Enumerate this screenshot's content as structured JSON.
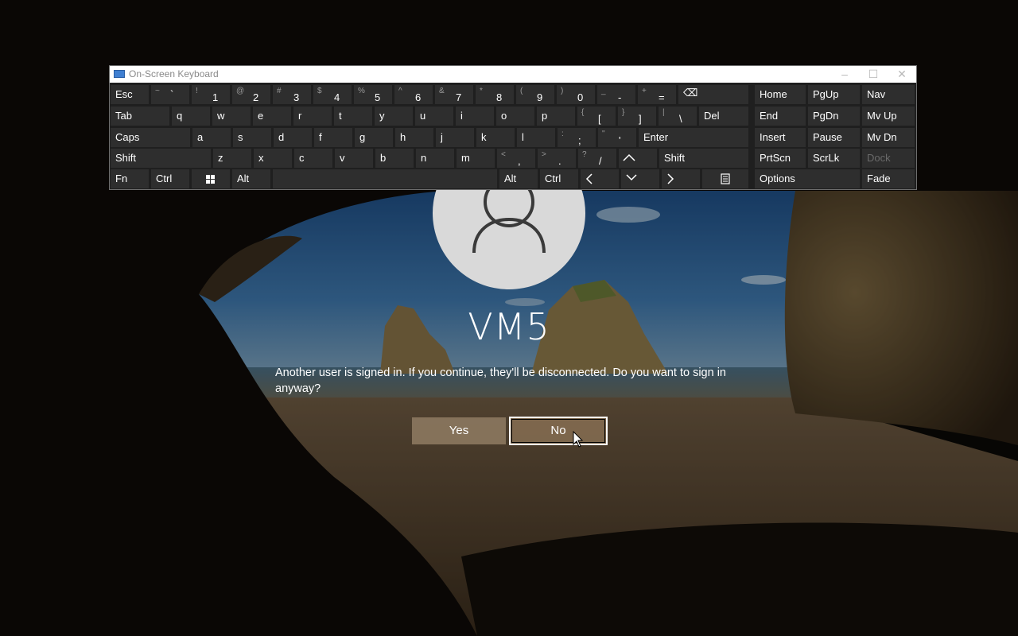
{
  "lockscreen": {
    "username": "VM5",
    "message": "Another user is signed in. If you continue, they'll be disconnected. Do you want to sign in anyway?",
    "yes_label": "Yes",
    "no_label": "No"
  },
  "osk": {
    "title": "On-Screen Keyboard",
    "minimize": "–",
    "maximize": "☐",
    "close": "✕",
    "row1": {
      "esc": "Esc",
      "tilde": {
        "sec": "~",
        "main": "`"
      },
      "k1": {
        "sec": "!",
        "main": "1"
      },
      "k2": {
        "sec": "@",
        "main": "2"
      },
      "k3": {
        "sec": "#",
        "main": "3"
      },
      "k4": {
        "sec": "$",
        "main": "4"
      },
      "k5": {
        "sec": "%",
        "main": "5"
      },
      "k6": {
        "sec": "^",
        "main": "6"
      },
      "k7": {
        "sec": "&",
        "main": "7"
      },
      "k8": {
        "sec": "*",
        "main": "8"
      },
      "k9": {
        "sec": "(",
        "main": "9"
      },
      "k0": {
        "sec": ")",
        "main": "0"
      },
      "minus": {
        "sec": "_",
        "main": "-"
      },
      "equals": {
        "sec": "+",
        "main": "="
      },
      "backspace": "⌫"
    },
    "row2": {
      "tab": "Tab",
      "q": "q",
      "w": "w",
      "e": "e",
      "r": "r",
      "t": "t",
      "y": "y",
      "u": "u",
      "i": "i",
      "o": "o",
      "p": "p",
      "lbracket": {
        "sec": "{",
        "main": "["
      },
      "rbracket": {
        "sec": "}",
        "main": "]"
      },
      "backslash": {
        "sec": "|",
        "main": "\\"
      },
      "del": "Del"
    },
    "row3": {
      "caps": "Caps",
      "a": "a",
      "s": "s",
      "d": "d",
      "f": "f",
      "g": "g",
      "h": "h",
      "j": "j",
      "k": "k",
      "l": "l",
      "semicolon": {
        "sec": ":",
        "main": ";"
      },
      "quote": {
        "sec": "\"",
        "main": "'"
      },
      "enter": "Enter"
    },
    "row4": {
      "shift_left": "Shift",
      "z": "z",
      "x": "x",
      "c": "c",
      "v": "v",
      "b": "b",
      "n": "n",
      "m": "m",
      "comma": {
        "sec": "<",
        "main": ","
      },
      "period": {
        "sec": ">",
        "main": "."
      },
      "slash": {
        "sec": "?",
        "main": "/"
      },
      "shift_right": "Shift"
    },
    "row5": {
      "fn": "Fn",
      "ctrl_left": "Ctrl",
      "alt_left": "Alt",
      "alt_right": "Alt",
      "ctrl_right": "Ctrl"
    },
    "nav": {
      "home": "Home",
      "pgup": "PgUp",
      "nav": "Nav",
      "end": "End",
      "pgdn": "PgDn",
      "mvup": "Mv Up",
      "insert": "Insert",
      "pause": "Pause",
      "mvdn": "Mv Dn",
      "prtscn": "PrtScn",
      "scrlk": "ScrLk",
      "dock": "Dock",
      "options": "Options",
      "fade": "Fade"
    }
  },
  "colors": {
    "key_bg": "#2e2e2e",
    "osk_bg": "#1f1f1f",
    "button_yes": "#968268",
    "button_no": "#80684e"
  }
}
